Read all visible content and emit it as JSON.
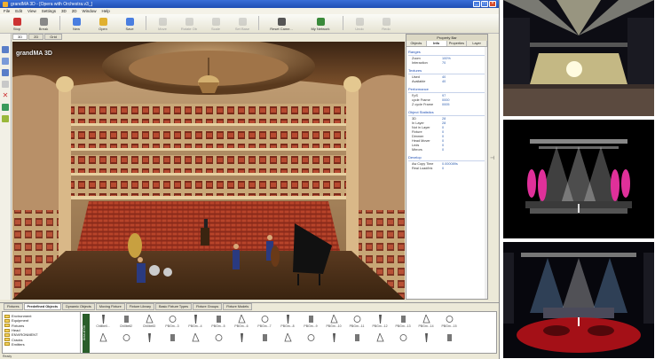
{
  "window": {
    "title": "grandMA 3D - [Opera with Orchestra.v3_]"
  },
  "menu": [
    "File",
    "Edit",
    "View",
    "Settings",
    "3D",
    "2D",
    "Window",
    "Help"
  ],
  "toolbar": [
    {
      "label": "Stop",
      "icon": "stop-icon",
      "enabled": true
    },
    {
      "label": "Break",
      "icon": "break-icon",
      "enabled": true
    },
    {
      "label": "New",
      "icon": "new-document-icon",
      "enabled": true
    },
    {
      "label": "Open",
      "icon": "open-folder-icon",
      "enabled": true
    },
    {
      "label": "Save",
      "icon": "save-icon",
      "enabled": true
    },
    {
      "label": "Move",
      "icon": "move-icon",
      "enabled": false
    },
    {
      "label": "Rotate Ob",
      "icon": "rotate-icon",
      "enabled": false
    },
    {
      "label": "Scale",
      "icon": "scale-icon",
      "enabled": false
    },
    {
      "label": "Set Base",
      "icon": "set-base-icon",
      "enabled": false
    },
    {
      "label": "Reset Came...",
      "icon": "camera-icon",
      "enabled": true
    },
    {
      "label": "My Network",
      "icon": "network-icon",
      "enabled": true
    },
    {
      "label": "Undo",
      "icon": "undo-icon",
      "enabled": false
    },
    {
      "label": "Redo",
      "icon": "redo-icon",
      "enabled": false
    }
  ],
  "view_tabs": [
    "3D",
    "2D",
    "Grid"
  ],
  "viewport_logo": "grandMA 3D",
  "property_bar": {
    "header": "Property Bar",
    "tabs": [
      "Objects",
      "Info",
      "Properties",
      "Layer"
    ],
    "active_tab": "Info",
    "groups": [
      {
        "title": "Ranges",
        "rows": [
          {
            "k": "Zoom",
            "v": "100%"
          },
          {
            "k": "Interaction",
            "v": "70"
          }
        ]
      },
      {
        "title": "Textures",
        "rows": [
          {
            "k": "Used",
            "v": "40"
          },
          {
            "k": "Available",
            "v": "40"
          }
        ]
      },
      {
        "title": "Performance",
        "rows": [
          {
            "k": "FpS",
            "v": "97"
          },
          {
            "k": "cycle Frame",
            "v": "0000"
          },
          {
            "k": "Z cycle Frame",
            "v": "0005"
          }
        ]
      },
      {
        "title": "Object Statistics",
        "rows": [
          {
            "k": "3D",
            "v": "28"
          },
          {
            "k": "In Layer",
            "v": "28"
          },
          {
            "k": "Not in Layer",
            "v": "0"
          },
          {
            "k": "Fixture",
            "v": "0"
          },
          {
            "k": "Dimmer",
            "v": "0"
          },
          {
            "k": "Head Mover",
            "v": "0"
          },
          {
            "k": "Leds",
            "v": "0"
          },
          {
            "k": "Mirrors",
            "v": "0"
          }
        ]
      },
      {
        "title": "Develop",
        "rows": [
          {
            "k": "Aw Copy Time",
            "v": "0.000089s"
          },
          {
            "k": "Real Load/Ink",
            "v": "0"
          }
        ]
      }
    ]
  },
  "bottom_tabs": [
    "Fixtures",
    "Predefined Objects",
    "Dynamic Objects",
    "Moving Fixture",
    "Fixture Library",
    "Basic Fixture Types",
    "Fixture Groups",
    "Fixture Models"
  ],
  "bottom_active_tab": "Predefined Objects",
  "tree": [
    "Environment",
    "Equipment",
    "Fixtures",
    "Head",
    "ENVIRONMENT",
    "Cracks",
    "Emitters"
  ],
  "library_selector": "Area of Ob",
  "library_row1": [
    "Chillbell...",
    "Chillbell2",
    "Chillbell3",
    "PBGm...3",
    "PBGm...4",
    "PBGm...5",
    "PBGm...6",
    "PBGm...7",
    "PBGm...8",
    "PBGm...9",
    "PBGm...10",
    "PBGm...11",
    "PBGm...12",
    "PBGm...13",
    "PBGm...14",
    "PBGm...15"
  ],
  "library_row2": [
    "",
    "",
    "",
    "",
    "",
    "",
    "",
    "",
    "",
    "",
    "",
    "",
    "",
    "",
    "",
    ""
  ],
  "status": "Ready"
}
